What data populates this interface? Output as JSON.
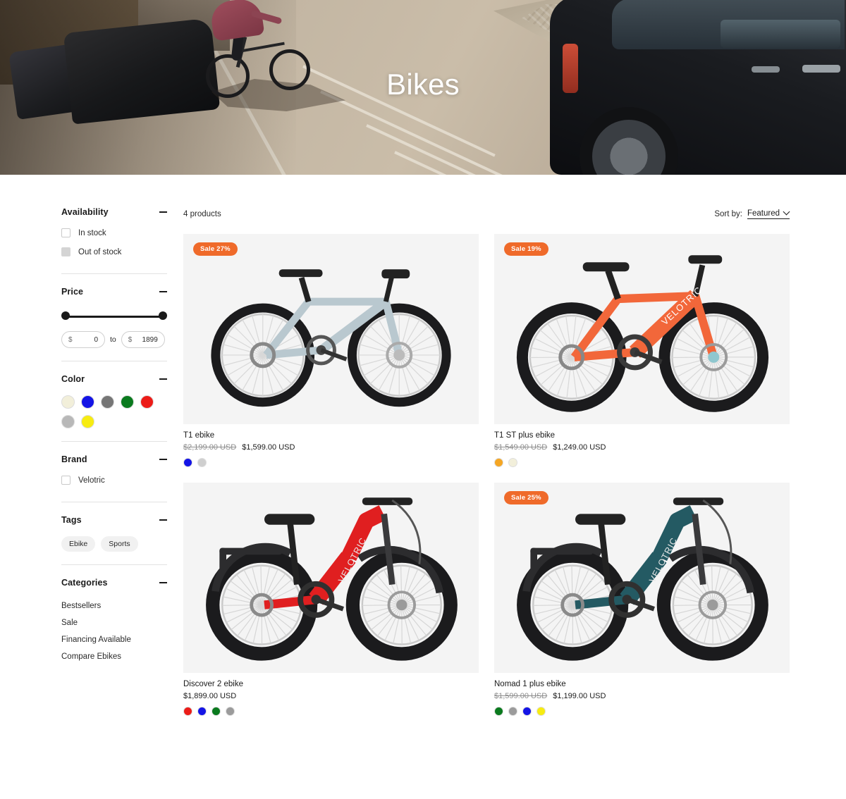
{
  "hero": {
    "title": "Bikes"
  },
  "sidebar": {
    "groups": [
      {
        "id": "availability",
        "title": "Availability",
        "collapse_icon": "minus-icon",
        "options": [
          {
            "label": "In stock",
            "checked": false,
            "style": "empty"
          },
          {
            "label": "Out of stock",
            "checked": false,
            "style": "filled"
          }
        ]
      },
      {
        "id": "price",
        "title": "Price",
        "collapse_icon": "minus-icon",
        "currency_symbol": "$",
        "min_value": "0",
        "max_value": "1899",
        "separator": "to",
        "min_placeholder": "0",
        "max_placeholder": "1899"
      },
      {
        "id": "color",
        "title": "Color",
        "collapse_icon": "minus-icon",
        "swatches": [
          {
            "name": "beige",
            "hex": "#f2efda"
          },
          {
            "name": "blue",
            "hex": "#1414e6"
          },
          {
            "name": "gray",
            "hex": "#767676"
          },
          {
            "name": "green",
            "hex": "#0a7a1e"
          },
          {
            "name": "red",
            "hex": "#ec1c18"
          },
          {
            "name": "light-gray",
            "hex": "#b8b8b8"
          },
          {
            "name": "yellow",
            "hex": "#f7ec11"
          }
        ]
      },
      {
        "id": "brand",
        "title": "Brand",
        "collapse_icon": "minus-icon",
        "options": [
          {
            "label": "Velotric",
            "checked": false,
            "style": "empty"
          }
        ]
      },
      {
        "id": "tags",
        "title": "Tags",
        "collapse_icon": "minus-icon",
        "tags": [
          "Ebike",
          "Sports"
        ]
      },
      {
        "id": "categories",
        "title": "Categories",
        "collapse_icon": "minus-icon",
        "items": [
          "Bestsellers",
          "Sale",
          "Financing Available",
          "Compare Ebikes"
        ]
      }
    ]
  },
  "main": {
    "product_count": "4 products",
    "sort": {
      "label": "Sort by:",
      "value": "Featured",
      "chevron_icon": "chevron-down-icon"
    },
    "products": [
      {
        "id": "t1-ebike",
        "title": "T1 ebike",
        "badge": "Sale 27%",
        "price_old": "$2,199.00 USD",
        "price_now": "$1,599.00 USD",
        "frame_color": "#b9c8cf",
        "swatches": [
          {
            "name": "blue",
            "hex": "#1414e6"
          },
          {
            "name": "light-gray",
            "hex": "#cfcfcf"
          }
        ]
      },
      {
        "id": "t1-st-plus-ebike",
        "title": "T1 ST plus ebike",
        "badge": "Sale 19%",
        "price_old": "$1,549.00 USD",
        "price_now": "$1,249.00 USD",
        "frame_color": "#f2673a",
        "swatches": [
          {
            "name": "orange",
            "hex": "#f5a623"
          },
          {
            "name": "cream",
            "hex": "#f2efda"
          }
        ]
      },
      {
        "id": "discover-2-ebike",
        "title": "Discover 2 ebike",
        "badge": "",
        "price_old": "",
        "price_now": "$1,899.00 USD",
        "frame_color": "#e01f20",
        "swatches": [
          {
            "name": "red",
            "hex": "#ec1c18"
          },
          {
            "name": "blue",
            "hex": "#1414e6"
          },
          {
            "name": "green",
            "hex": "#0a7a1e"
          },
          {
            "name": "gray",
            "hex": "#9b9b9b"
          }
        ]
      },
      {
        "id": "nomad-1-plus-ebike",
        "title": "Nomad 1 plus ebike",
        "badge": "Sale 25%",
        "price_old": "$1,599.00 USD",
        "price_now": "$1,199.00 USD",
        "frame_color": "#245a63",
        "swatches": [
          {
            "name": "green",
            "hex": "#0a7a1e"
          },
          {
            "name": "gray",
            "hex": "#9b9b9b"
          },
          {
            "name": "blue",
            "hex": "#1414e6"
          },
          {
            "name": "yellow",
            "hex": "#f7ec11"
          }
        ]
      }
    ]
  }
}
